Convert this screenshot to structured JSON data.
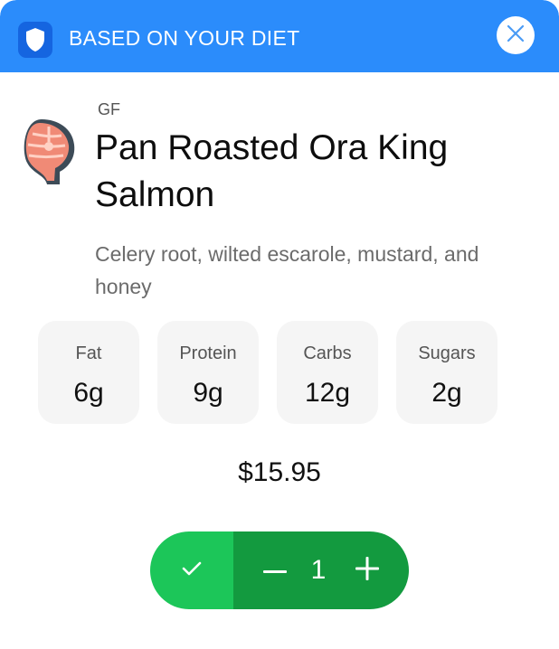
{
  "banner": {
    "title": "BASED ON YOUR DIET",
    "icon": "shield-icon",
    "close_icon": "close-icon",
    "color": "#2b8cfb"
  },
  "dish": {
    "tag": "GF",
    "name": "Pan Roasted Ora King Salmon",
    "description": "Celery root, wilted escarole, mustard, and honey",
    "icon": "salmon-steak-icon"
  },
  "nutrition": [
    {
      "label": "Fat",
      "value": "6g"
    },
    {
      "label": "Protein",
      "value": "9g"
    },
    {
      "label": "Carbs",
      "value": "12g"
    },
    {
      "label": "Sugars",
      "value": "2g"
    }
  ],
  "price": "$15.95",
  "stepper": {
    "quantity": "1",
    "check_icon": "check-icon",
    "minus_icon": "minus-icon",
    "plus_icon": "plus-icon",
    "confirm_color": "#1cc659",
    "stepper_color": "#139a3f"
  }
}
